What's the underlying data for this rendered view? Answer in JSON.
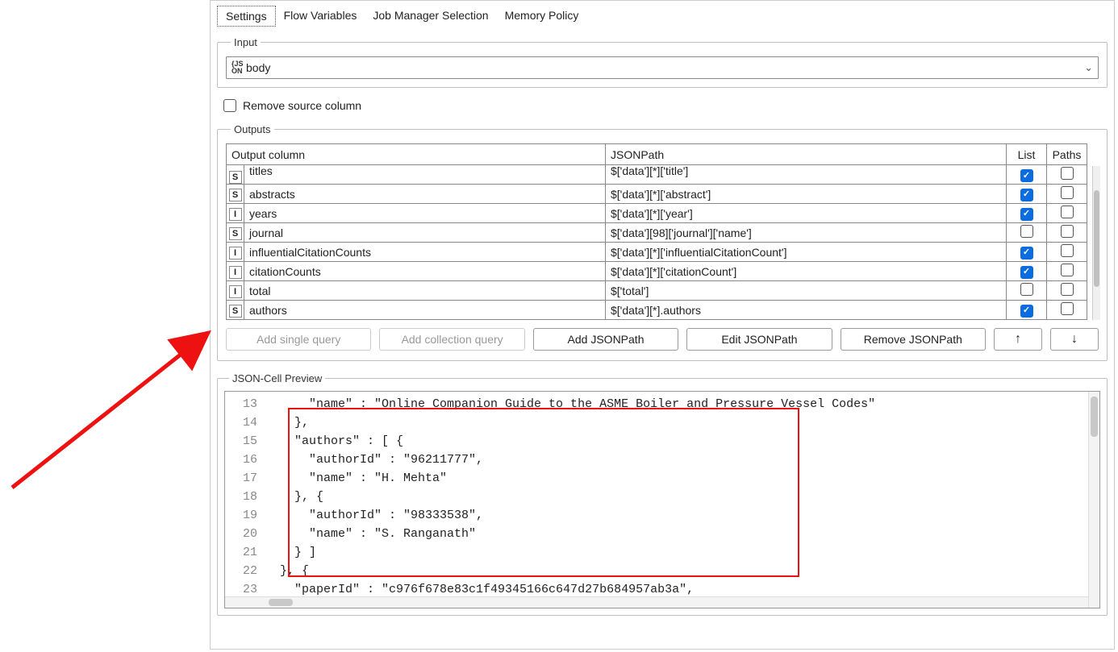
{
  "tabs": [
    {
      "label": "Settings",
      "active": true
    },
    {
      "label": "Flow Variables",
      "active": false
    },
    {
      "label": "Job Manager Selection",
      "active": false
    },
    {
      "label": "Memory Policy",
      "active": false
    }
  ],
  "input": {
    "legend": "Input",
    "icon_label": "{JS\nON",
    "value": "body"
  },
  "remove_source": {
    "label": "Remove source column",
    "checked": false
  },
  "outputs": {
    "legend": "Outputs",
    "headers": {
      "output_col": "Output column",
      "jsonpath": "JSONPath",
      "list": "List",
      "paths": "Paths"
    },
    "rows": [
      {
        "type": "S",
        "name": "titles",
        "path": "$['data'][*]['title']",
        "list": true,
        "paths": false,
        "clipped": true
      },
      {
        "type": "S",
        "name": "abstracts",
        "path": "$['data'][*]['abstract']",
        "list": true,
        "paths": false
      },
      {
        "type": "I",
        "name": "years",
        "path": "$['data'][*]['year']",
        "list": true,
        "paths": false
      },
      {
        "type": "S",
        "name": "journal",
        "path": "$['data'][98]['journal']['name']",
        "list": false,
        "paths": false
      },
      {
        "type": "I",
        "name": "influentialCitationCounts",
        "path": "$['data'][*]['influentialCitationCount']",
        "list": true,
        "paths": false
      },
      {
        "type": "I",
        "name": "citationCounts",
        "path": "$['data'][*]['citationCount']",
        "list": true,
        "paths": false
      },
      {
        "type": "I",
        "name": "total",
        "path": "$['total']",
        "list": false,
        "paths": false
      },
      {
        "type": "S",
        "name": "authors",
        "path": "$['data'][*].authors",
        "list": true,
        "paths": false
      }
    ],
    "buttons": {
      "add_single": "Add single query",
      "add_collection": "Add collection query",
      "add_jsonpath": "Add JSONPath",
      "edit_jsonpath": "Edit JSONPath",
      "remove_jsonpath": "Remove JSONPath",
      "move_up": "↑",
      "move_down": "↓"
    }
  },
  "preview": {
    "legend": "JSON-Cell Preview",
    "lines": [
      {
        "n": 13,
        "text": "      \"name\" : \"Online Companion Guide to the ASME Boiler and Pressure Vessel Codes\""
      },
      {
        "n": 14,
        "text": "    },"
      },
      {
        "n": 15,
        "text": "    \"authors\" : [ {"
      },
      {
        "n": 16,
        "text": "      \"authorId\" : \"96211777\","
      },
      {
        "n": 17,
        "text": "      \"name\" : \"H. Mehta\""
      },
      {
        "n": 18,
        "text": "    }, {"
      },
      {
        "n": 19,
        "text": "      \"authorId\" : \"98333538\","
      },
      {
        "n": 20,
        "text": "      \"name\" : \"S. Ranganath\""
      },
      {
        "n": 21,
        "text": "    } ]"
      },
      {
        "n": 22,
        "text": "  }, {"
      },
      {
        "n": 23,
        "text": "    \"paperId\" : \"c976f678e83c1f49345166c647d27b684957ab3a\","
      }
    ]
  }
}
